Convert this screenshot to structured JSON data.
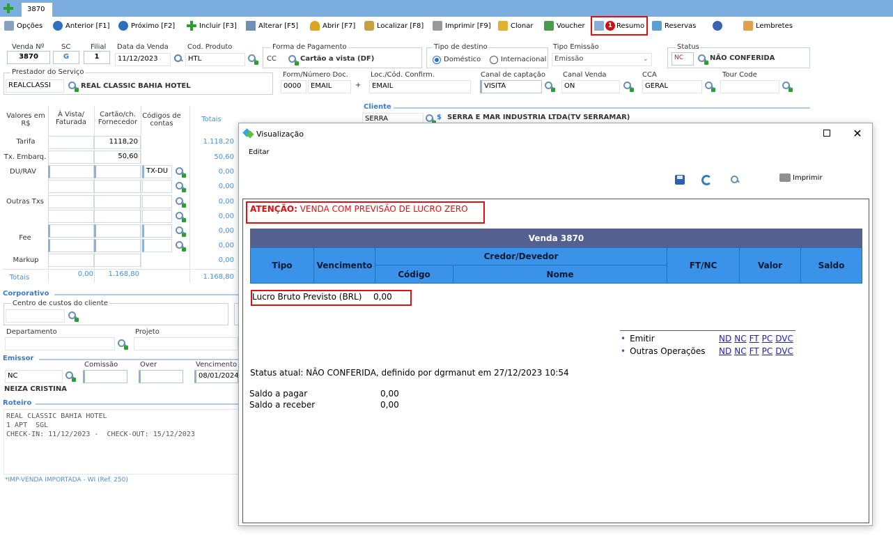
{
  "tab": {
    "label": "3870"
  },
  "toolbar": {
    "opcoes": "Opções",
    "anterior": "Anterior [F1]",
    "proximo": "Próximo [F2]",
    "incluir": "Incluir [F3]",
    "alterar": "Alterar [F5]",
    "abrir": "Abrir [F7]",
    "localizar": "Localizar [F8]",
    "imprimir": "Imprimir [F9]",
    "clonar": "Clonar",
    "voucher": "Voucher",
    "resumo": "Resumo",
    "resumo_badge": "1",
    "reservas": "Reservas",
    "lembretes": "Lembretes"
  },
  "header": {
    "venda_label": "Venda Nº",
    "venda_value": "3870",
    "sc_label": "SC",
    "sc_value": "G",
    "filial_label": "Filial",
    "filial_value": "1",
    "data_label": "Data da Venda",
    "data_value": "11/12/2023",
    "codprod_label": "Cod. Produto",
    "codprod_value": "HTL",
    "pagto_label": "Forma de Pagamento",
    "pagto_code": "CC",
    "pagto_value": "Cartão a vista (DF)",
    "destino_label": "Tipo de destino",
    "domestico": "Doméstico",
    "internacional": "Internacional",
    "emissao_label": "Tipo Emissão",
    "emissao_value": "Emissão",
    "status_label": "Status",
    "status_code": "NC",
    "status_value": "NÃO CONFERIDA",
    "prestador_label": "Prestador do Serviço",
    "prestador_code": "REALCLASSI",
    "prestador_value": "REAL CLASSIC BAHIA HOTEL",
    "formdoc_label": "Form/Número Doc.",
    "formdoc_a": "0000",
    "formdoc_b": "EMAIL",
    "plus": "+",
    "loc_label": "Loc./Cód. Confirm.",
    "loc_value": "EMAIL",
    "canal_cap_label": "Canal de captação",
    "canal_cap_value": "VISITA",
    "canal_venda_label": "Canal Venda",
    "canal_venda_value": "ON",
    "cca_label": "CCA",
    "cca_value": "GERAL",
    "tour_label": "Tour Code",
    "cliente_label": "Cliente",
    "cliente_code": "SERRA",
    "cliente_dollar": "$",
    "cliente_value": "SERRA E MAR INDUSTRIA LTDA(TV SERRAMAR)"
  },
  "values_table": {
    "h_valores": "Valores em R$",
    "h_avista": "À Vista/ Faturada",
    "h_cartao": "Cartão/ch. Fornecedor",
    "h_codigos": "Códigos de contas",
    "h_totais": "Totais",
    "tarifa": "Tarifa",
    "tarifa_cartao": "1118,20",
    "tarifa_total": "1.118,20",
    "embarq": "Tx. Embarq.",
    "embarq_cartao": "50,60",
    "embarq_total": "50,60",
    "du": "DU/RAV",
    "du_code": "TX-DU",
    "outras": "Outras Txs",
    "fee": "Fee",
    "markup": "Markup",
    "zero": "0,00",
    "totais": "Totais",
    "tot_avista": "0,00",
    "tot_cartao": "1.168,80",
    "tot_total": "1.168,80"
  },
  "corporativo": {
    "title": "Corporativo",
    "centro": "Centro de custos do cliente",
    "depto": "Departamento",
    "projeto": "Projeto"
  },
  "emissor": {
    "title": "Emissor",
    "code": "NC",
    "comissao": "Comissão",
    "over": "Over",
    "vencimento": "Vencimento",
    "venc_value": "08/01/2024",
    "nome": "NEIZA CRISTINA"
  },
  "roteiro": {
    "title": "Roteiro",
    "line1": "REAL CLASSIC BAHIA HOTEL",
    "line2": "1 APT  SGL",
    "line3": "CHECK-IN: 11/12/2023 -  CHECK-OUT: 15/12/2023",
    "note": "*IMP-VENDA IMPORTADA - WI (Ref. 250)"
  },
  "dialog": {
    "title": "Visualização",
    "menu_editar": "Editar",
    "imprimir": "Imprimir",
    "attention_label": "ATENÇÃO:",
    "attention_text": "VENDA COM PREVISÃO DE LUCRO ZERO",
    "table_title": "Venda  3870",
    "col_tipo": "Tipo",
    "col_venc": "Vencimento",
    "col_cred": "Credor/Devedor",
    "col_codigo": "Código",
    "col_nome": "Nome",
    "col_ftnc": "FT/NC",
    "col_valor": "Valor",
    "col_saldo": "Saldo",
    "lucro_label": "Lucro Bruto Previsto (BRL)",
    "lucro_value": "0,00",
    "emitir": "Emitir",
    "outras": "Outras Operações",
    "links": [
      "ND",
      "NC",
      "FT",
      "PC",
      "DVC"
    ],
    "status_text": "Status atual: NÃO CONFERIDA, definido por dgrmanut em 27/12/2023 10:54",
    "saldo_pagar": "Saldo a pagar",
    "saldo_pagar_value": "0,00",
    "saldo_receber": "Saldo a receber",
    "saldo_receber_value": "0,00"
  },
  "colors": {
    "titlebar": "#7badde",
    "header_blue": "#546190",
    "table_head": "#3a93e8",
    "alert": "#e01010"
  }
}
